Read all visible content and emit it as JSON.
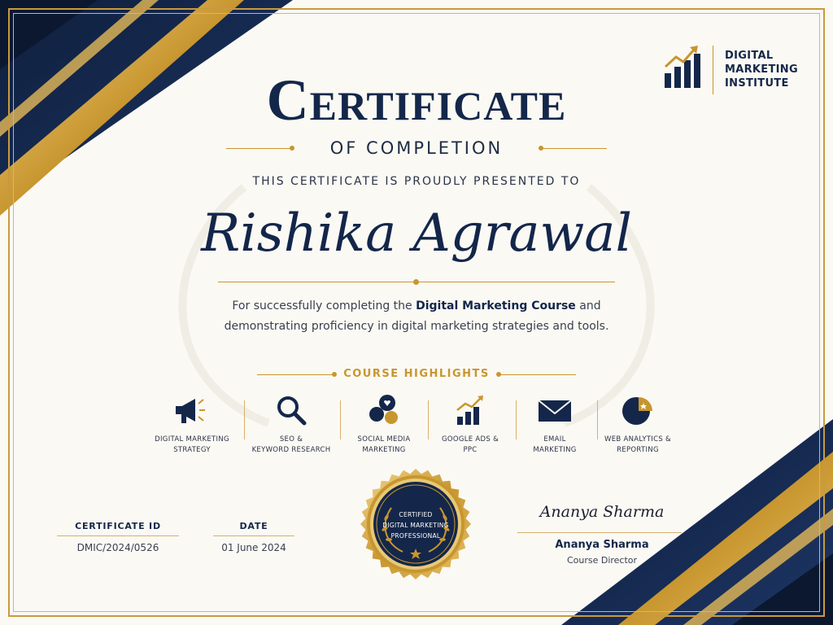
{
  "colors": {
    "navy": "#14274a",
    "gold": "#c8962f",
    "paper": "#fbf9f4"
  },
  "brand": {
    "name_lines": "DIGITAL\nMARKETING\nINSTITUTE",
    "logo_icon": "bar-chart-growth-icon"
  },
  "certificate": {
    "title": "Certificate",
    "subtitle": "OF COMPLETION",
    "presented_to": "THIS CERTIFICATE IS PROUDLY PRESENTED TO",
    "recipient": "Rishika Agrawal",
    "description_before": "For successfully completing the ",
    "course_name": "Digital Marketing Course",
    "description_after": " and demonstrating proficiency in digital marketing strategies and tools."
  },
  "highlights": {
    "heading": "COURSE HIGHLIGHTS",
    "items": [
      {
        "label": "DIGITAL MARKETING\nSTRATEGY",
        "icon": "megaphone-icon"
      },
      {
        "label": "SEO &\nKEYWORD RESEARCH",
        "icon": "magnifier-icon"
      },
      {
        "label": "SOCIAL MEDIA\nMARKETING",
        "icon": "social-bubbles-icon"
      },
      {
        "label": "GOOGLE ADS &\nPPC",
        "icon": "growth-chart-icon"
      },
      {
        "label": "EMAIL\nMARKETING",
        "icon": "envelope-icon"
      },
      {
        "label": "WEB ANALYTICS &\nREPORTING",
        "icon": "pie-chart-icon"
      }
    ]
  },
  "details": {
    "certificate_id_label": "CERTIFICATE ID",
    "certificate_id": "DMIC/2024/0526",
    "date_label": "DATE",
    "date": "01 June 2024"
  },
  "seal": {
    "text": "CERTIFIED\nDIGITAL MARKETING\nPROFESSIONAL"
  },
  "signature": {
    "script": "Ananya Sharma",
    "name": "Ananya Sharma",
    "title": "Course Director"
  }
}
